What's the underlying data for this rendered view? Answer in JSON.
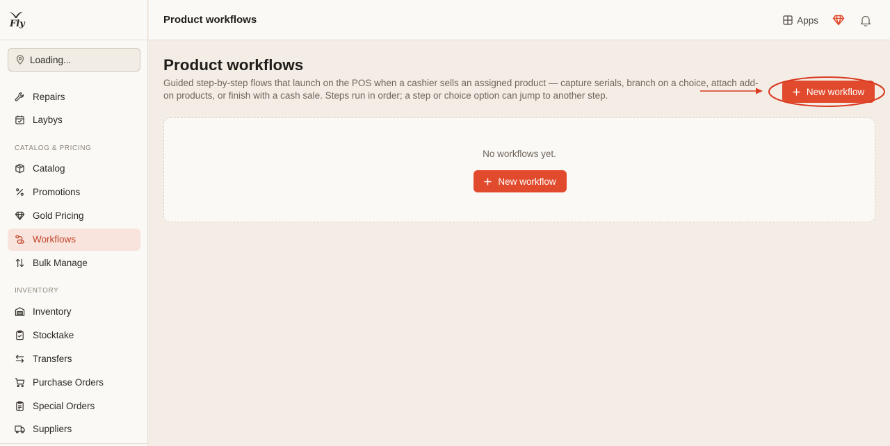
{
  "logo": {
    "text": "Fly"
  },
  "location": {
    "label": "Loading..."
  },
  "sidebar": {
    "items_top": [
      {
        "label": "Repairs",
        "icon": "wrench-icon"
      },
      {
        "label": "Laybys",
        "icon": "calendar-icon"
      }
    ],
    "section_catalog": "CATALOG & PRICING",
    "items_catalog": [
      {
        "label": "Catalog",
        "icon": "box-icon"
      },
      {
        "label": "Promotions",
        "icon": "percent-icon"
      },
      {
        "label": "Gold Pricing",
        "icon": "gem-icon"
      },
      {
        "label": "Workflows",
        "icon": "workflow-icon",
        "active": true
      },
      {
        "label": "Bulk Manage",
        "icon": "sort-arrows-icon"
      }
    ],
    "section_inventory": "INVENTORY",
    "items_inventory": [
      {
        "label": "Inventory",
        "icon": "warehouse-icon"
      },
      {
        "label": "Stocktake",
        "icon": "clipboard-icon"
      },
      {
        "label": "Transfers",
        "icon": "transfer-icon"
      },
      {
        "label": "Purchase Orders",
        "icon": "cart-icon"
      },
      {
        "label": "Special Orders",
        "icon": "clipboard-list-icon"
      },
      {
        "label": "Suppliers",
        "icon": "truck-icon"
      }
    ]
  },
  "header": {
    "title": "Product workflows",
    "apps_label": "Apps"
  },
  "main": {
    "title": "Product workflows",
    "description": "Guided step-by-step flows that launch on the POS when a cashier sells an assigned product — capture serials, branch on a choice, attach add-on products, or finish with a cash sale. Steps run in order; a step or choice option can jump to another step.",
    "new_button_label": "New workflow",
    "empty_text": "No workflows yet.",
    "empty_button_label": "New workflow"
  },
  "colors": {
    "accent": "#e14a2c",
    "active_bg": "#f8e4dc",
    "annotation": "#d93a22"
  }
}
